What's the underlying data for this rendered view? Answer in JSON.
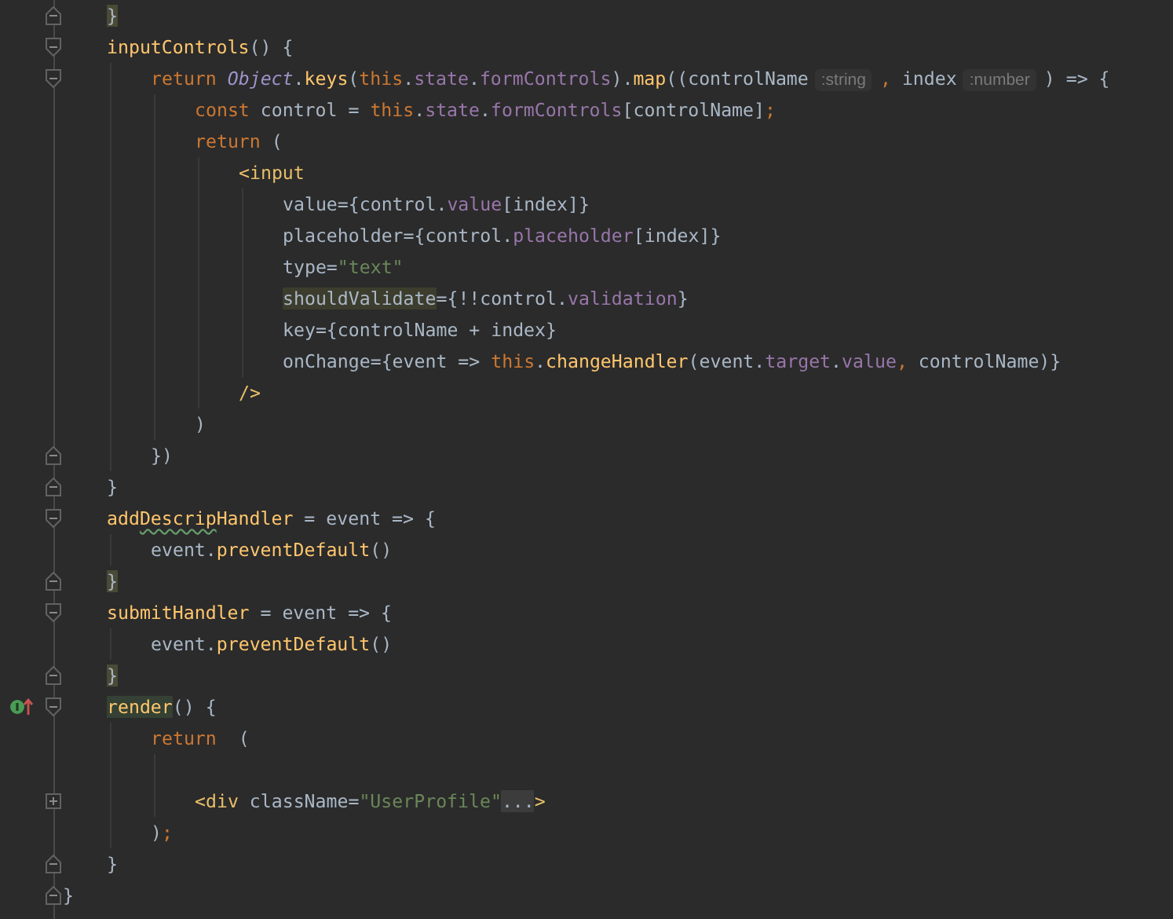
{
  "class_body": [
    {
      "fold": {
        "kind": "end"
      },
      "tokens": [
        {
          "text": "}",
          "kind": "plain",
          "highlight": {
            "kind": "match"
          }
        }
      ]
    },
    {
      "fold": {
        "kind": "start"
      },
      "tokens": [
        {
          "text": "inputControls",
          "kind": "method"
        },
        {
          "text": "() {",
          "kind": "plain"
        }
      ],
      "children": [
        {
          "fold": {
            "kind": "start"
          },
          "tokens": [
            {
              "text": "return ",
              "kind": "keyword"
            },
            {
              "text": "Object",
              "kind": "class"
            },
            {
              "text": ".",
              "kind": "plain"
            },
            {
              "text": "keys",
              "kind": "method"
            },
            {
              "text": "(",
              "kind": "plain"
            },
            {
              "text": "this",
              "kind": "keyword"
            },
            {
              "text": ".",
              "kind": "plain"
            },
            {
              "text": "state",
              "kind": "property"
            },
            {
              "text": ".",
              "kind": "plain"
            },
            {
              "text": "formControls",
              "kind": "property"
            },
            {
              "text": ").",
              "kind": "plain"
            },
            {
              "text": "map",
              "kind": "method"
            },
            {
              "text": "((controlName",
              "kind": "plain"
            },
            {
              "text": ":string",
              "kind": "hint"
            },
            {
              "text": ",",
              "kind": "keyword"
            },
            {
              "text": " index",
              "kind": "plain"
            },
            {
              "text": ":number",
              "kind": "hint"
            },
            {
              "text": ") => {",
              "kind": "plain"
            }
          ],
          "children": [
            {
              "tokens": [
                {
                  "text": "const",
                  "kind": "keyword"
                },
                {
                  "text": " control = ",
                  "kind": "plain"
                },
                {
                  "text": "this",
                  "kind": "keyword"
                },
                {
                  "text": ".",
                  "kind": "plain"
                },
                {
                  "text": "state",
                  "kind": "property"
                },
                {
                  "text": ".",
                  "kind": "plain"
                },
                {
                  "text": "formControls",
                  "kind": "property"
                },
                {
                  "text": "[controlName]",
                  "kind": "plain"
                },
                {
                  "text": ";",
                  "kind": "keyword"
                }
              ]
            },
            {
              "tokens": [
                {
                  "text": "return",
                  "kind": "keyword"
                },
                {
                  "text": " (",
                  "kind": "plain"
                }
              ],
              "children": [
                {
                  "tokens": [
                    {
                      "text": "<input",
                      "kind": "tag"
                    }
                  ],
                  "children": [
                    {
                      "tokens": [
                        {
                          "text": "value={control.",
                          "kind": "plain"
                        },
                        {
                          "text": "value",
                          "kind": "property"
                        },
                        {
                          "text": "[index]}",
                          "kind": "plain"
                        }
                      ]
                    },
                    {
                      "tokens": [
                        {
                          "text": "placeholder={control.",
                          "kind": "plain"
                        },
                        {
                          "text": "placeholder",
                          "kind": "property"
                        },
                        {
                          "text": "[index]}",
                          "kind": "plain"
                        }
                      ]
                    },
                    {
                      "tokens": [
                        {
                          "text": "type=",
                          "kind": "plain"
                        },
                        {
                          "text": "\"text\"",
                          "kind": "string"
                        }
                      ]
                    },
                    {
                      "tokens": [
                        {
                          "text": "shouldValidate",
                          "kind": "plain",
                          "highlight": {
                            "kind": "usage"
                          }
                        },
                        {
                          "text": "={!!control.",
                          "kind": "plain"
                        },
                        {
                          "text": "validation",
                          "kind": "property"
                        },
                        {
                          "text": "}",
                          "kind": "plain"
                        }
                      ]
                    },
                    {
                      "tokens": [
                        {
                          "text": "key={controlName + index}",
                          "kind": "plain"
                        }
                      ]
                    },
                    {
                      "tokens": [
                        {
                          "text": "onChange={event => ",
                          "kind": "plain"
                        },
                        {
                          "text": "this",
                          "kind": "keyword"
                        },
                        {
                          "text": ".",
                          "kind": "plain"
                        },
                        {
                          "text": "changeHandler",
                          "kind": "method"
                        },
                        {
                          "text": "(event.",
                          "kind": "plain"
                        },
                        {
                          "text": "target",
                          "kind": "property"
                        },
                        {
                          "text": ".",
                          "kind": "plain"
                        },
                        {
                          "text": "value",
                          "kind": "property"
                        },
                        {
                          "text": ",",
                          "kind": "keyword"
                        },
                        {
                          "text": " controlName)}",
                          "kind": "plain"
                        }
                      ]
                    }
                  ]
                },
                {
                  "tokens": [
                    {
                      "text": "/>",
                      "kind": "tag"
                    }
                  ]
                }
              ]
            },
            {
              "tokens": [
                {
                  "text": ")",
                  "kind": "plain"
                }
              ]
            }
          ]
        },
        {
          "fold": {
            "kind": "end"
          },
          "tokens": [
            {
              "text": "})",
              "kind": "plain"
            }
          ]
        }
      ]
    },
    {
      "fold": {
        "kind": "end"
      },
      "tokens": [
        {
          "text": "}",
          "kind": "plain"
        }
      ]
    },
    {
      "fold": {
        "kind": "start"
      },
      "tokens": [
        {
          "text": "add",
          "kind": "method"
        },
        {
          "text": "Descrip",
          "kind": "method",
          "highlight": {
            "kind": "typo"
          }
        },
        {
          "text": "Handler",
          "kind": "method"
        },
        {
          "text": " = event => {",
          "kind": "plain"
        }
      ],
      "children": [
        {
          "tokens": [
            {
              "text": "event.",
              "kind": "plain"
            },
            {
              "text": "preventDefault",
              "kind": "method"
            },
            {
              "text": "()",
              "kind": "plain"
            }
          ]
        }
      ]
    },
    {
      "fold": {
        "kind": "end"
      },
      "tokens": [
        {
          "text": "}",
          "kind": "plain",
          "highlight": {
            "kind": "match"
          }
        }
      ]
    },
    {
      "fold": {
        "kind": "start"
      },
      "tokens": [
        {
          "text": "submitHandler",
          "kind": "method"
        },
        {
          "text": " = event => {",
          "kind": "plain"
        }
      ],
      "children": [
        {
          "tokens": [
            {
              "text": "event.",
              "kind": "plain"
            },
            {
              "text": "preventDefault",
              "kind": "method"
            },
            {
              "text": "()",
              "kind": "plain"
            }
          ]
        }
      ]
    },
    {
      "fold": {
        "kind": "end"
      },
      "tokens": [
        {
          "text": "}",
          "kind": "plain",
          "highlight": {
            "kind": "match"
          }
        }
      ]
    },
    {
      "fold": {
        "kind": "start"
      },
      "gutter_marker": {
        "kind": "implements"
      },
      "tokens": [
        {
          "text": "render",
          "kind": "method",
          "highlight": {
            "kind": "definition"
          }
        },
        {
          "text": "() {",
          "kind": "plain"
        }
      ],
      "children": [
        {
          "tokens": [
            {
              "text": "return",
              "kind": "keyword"
            },
            {
              "text": "  (",
              "kind": "plain"
            }
          ],
          "children": [
            {
              "blank_before": true,
              "fold": {
                "kind": "collapsed"
              },
              "tokens": [
                {
                  "text": "<div",
                  "kind": "tag"
                },
                {
                  "text": " className=",
                  "kind": "plain"
                },
                {
                  "text": "\"UserProfile\"",
                  "kind": "string"
                },
                {
                  "text": "...",
                  "kind": "plain",
                  "highlight": {
                    "kind": "folded"
                  }
                },
                {
                  "text": ">",
                  "kind": "tag"
                }
              ]
            }
          ]
        },
        {
          "tokens": [
            {
              "text": ")",
              "kind": "plain"
            },
            {
              "text": ";",
              "kind": "keyword"
            }
          ]
        }
      ]
    },
    {
      "fold": {
        "kind": "end"
      },
      "tokens": [
        {
          "text": "}",
          "kind": "plain"
        }
      ]
    }
  ],
  "closing_line": {
    "fold": {
      "kind": "end"
    },
    "tokens": [
      {
        "text": "}",
        "kind": "plain"
      }
    ]
  }
}
